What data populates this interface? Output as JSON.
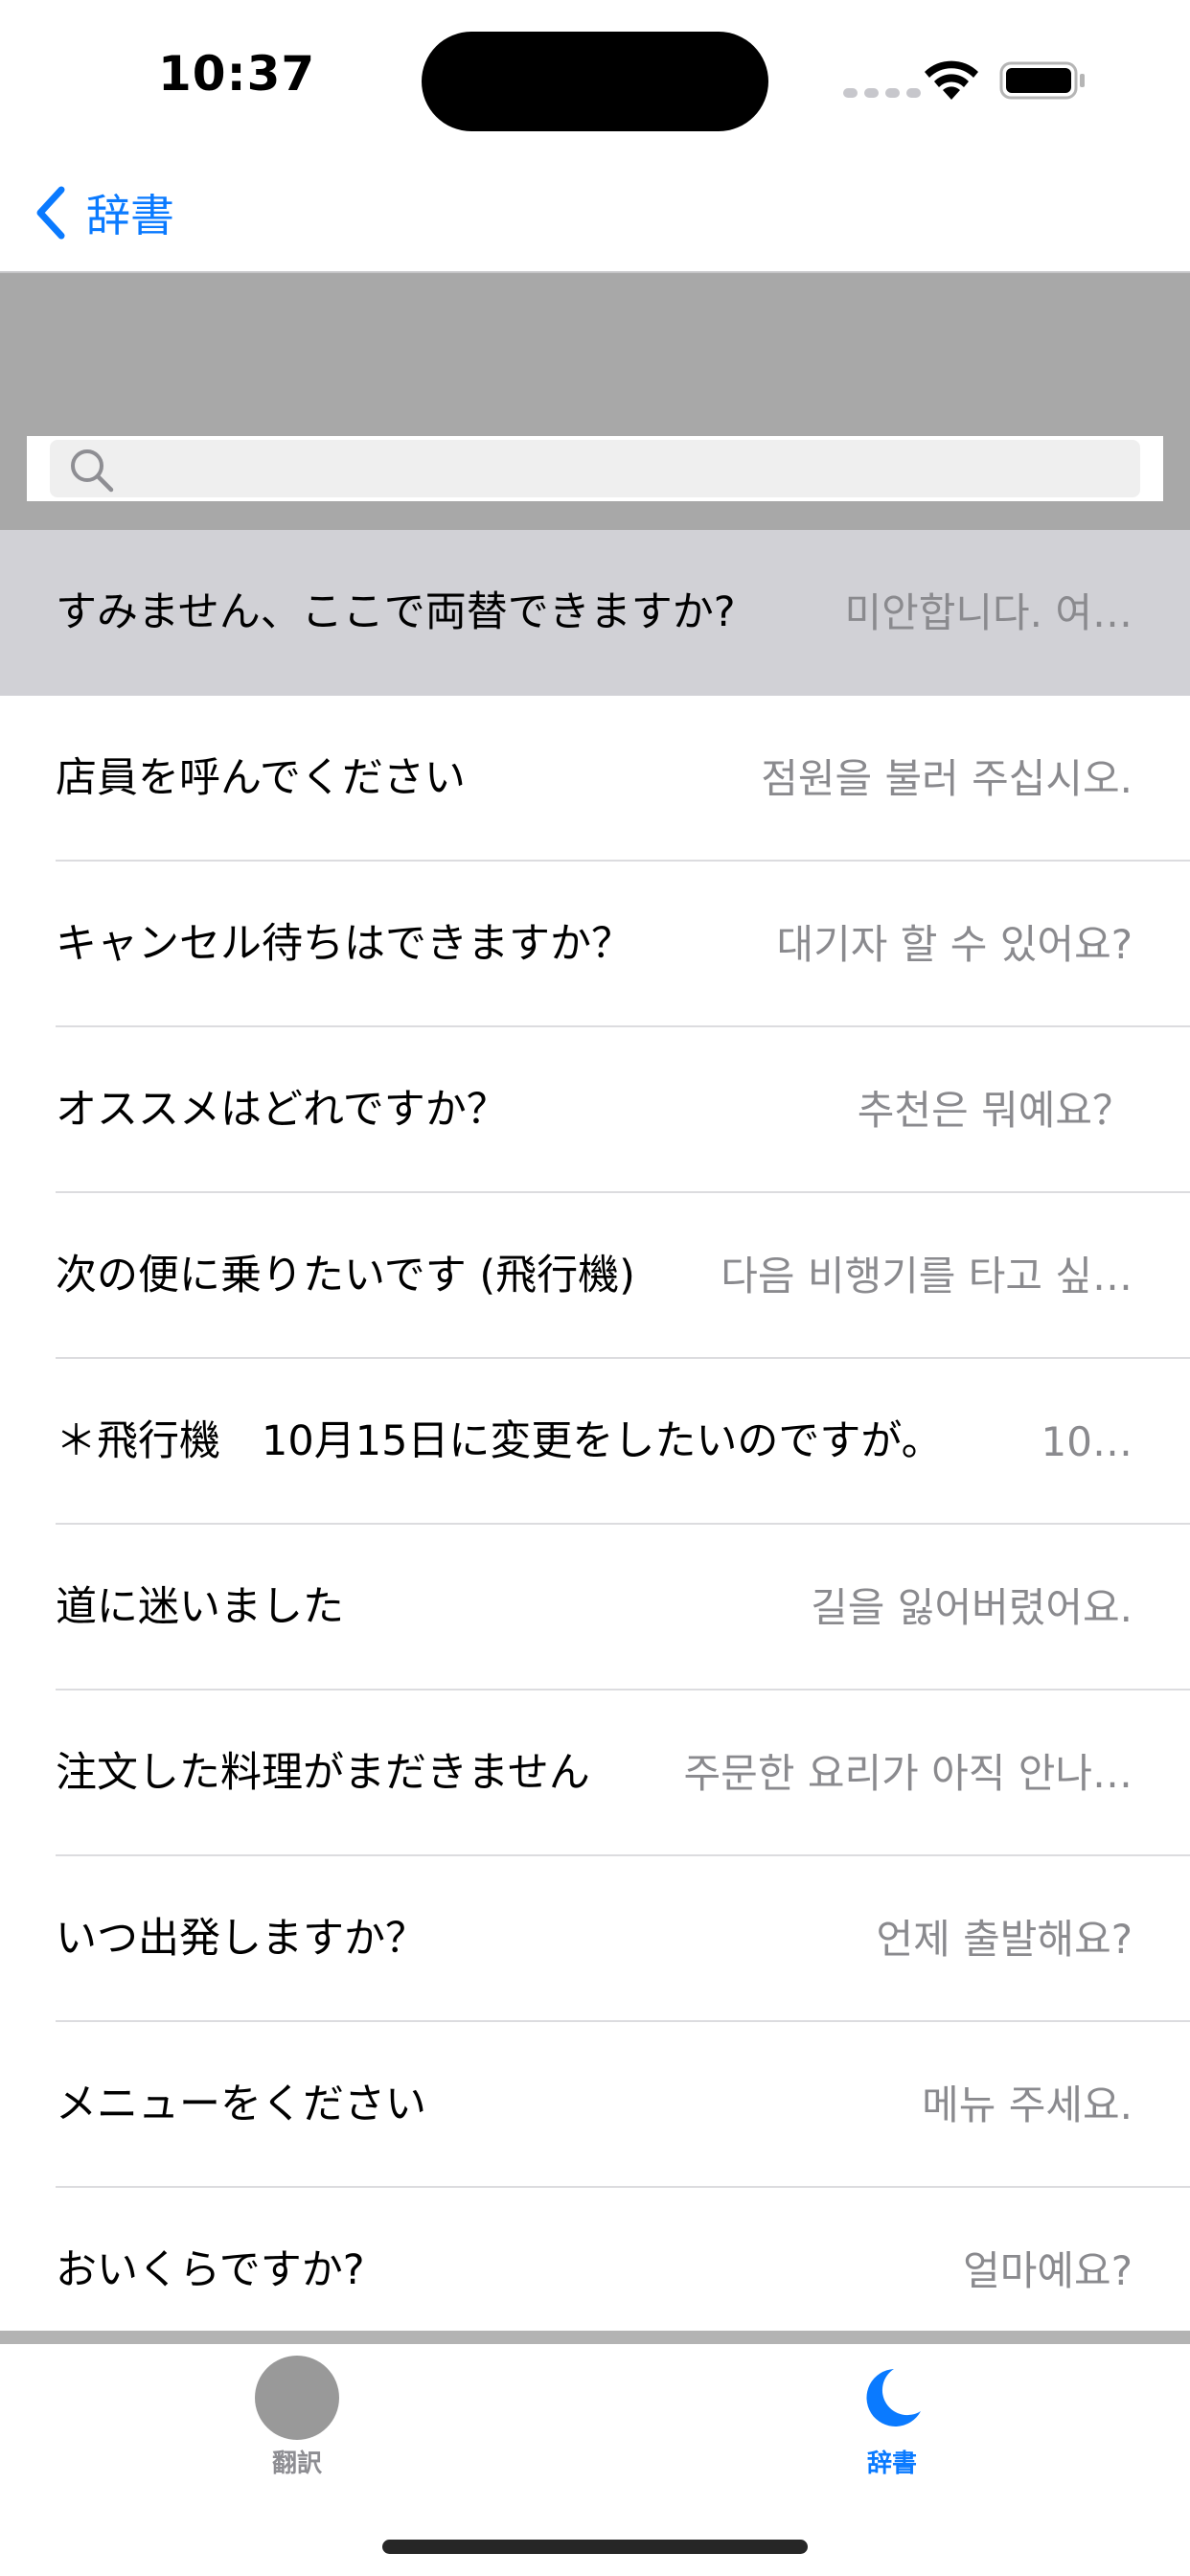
{
  "status_bar": {
    "time": "10:37"
  },
  "nav": {
    "back_label": "辞書"
  },
  "search": {
    "placeholder": ""
  },
  "phrases": [
    {
      "jp": "すみません、ここで両替できますか?",
      "ko": "미안합니다. 여…",
      "selected": true
    },
    {
      "jp": "店員を呼んでください",
      "ko": "점원을 불러 주십시오."
    },
    {
      "jp": "キャンセル待ちはできますか？",
      "ko": "대기자 할 수 있어요?"
    },
    {
      "jp": "オススメはどれですか？",
      "ko": "추천은 뭐예요？"
    },
    {
      "jp": "次の便に乗りたいです (飛行機)",
      "ko": "다음 비행기를 타고 싶…"
    },
    {
      "jp": "＊飛行機　10月15日に変更をしたいのですが。",
      "ko": "10…"
    },
    {
      "jp": "道に迷いました",
      "ko": "길을 잃어버렸어요."
    },
    {
      "jp": "注文した料理がまだきません",
      "ko": "주문한 요리가 아직 안나…"
    },
    {
      "jp": "いつ出発しますか？",
      "ko": "언제 출발해요?"
    },
    {
      "jp": "メニューをください",
      "ko": "메뉴 주세요."
    },
    {
      "jp": "おいくらですか?",
      "ko": "얼마예요?"
    }
  ],
  "tabs": {
    "translate_label": "翻訳",
    "dictionary_label": "辞書"
  },
  "colors": {
    "accent": "#0a7aff",
    "header_gray": "#a8a8a8",
    "selected_row": "#d1d1d6",
    "secondary_text": "#8a8a8e"
  }
}
